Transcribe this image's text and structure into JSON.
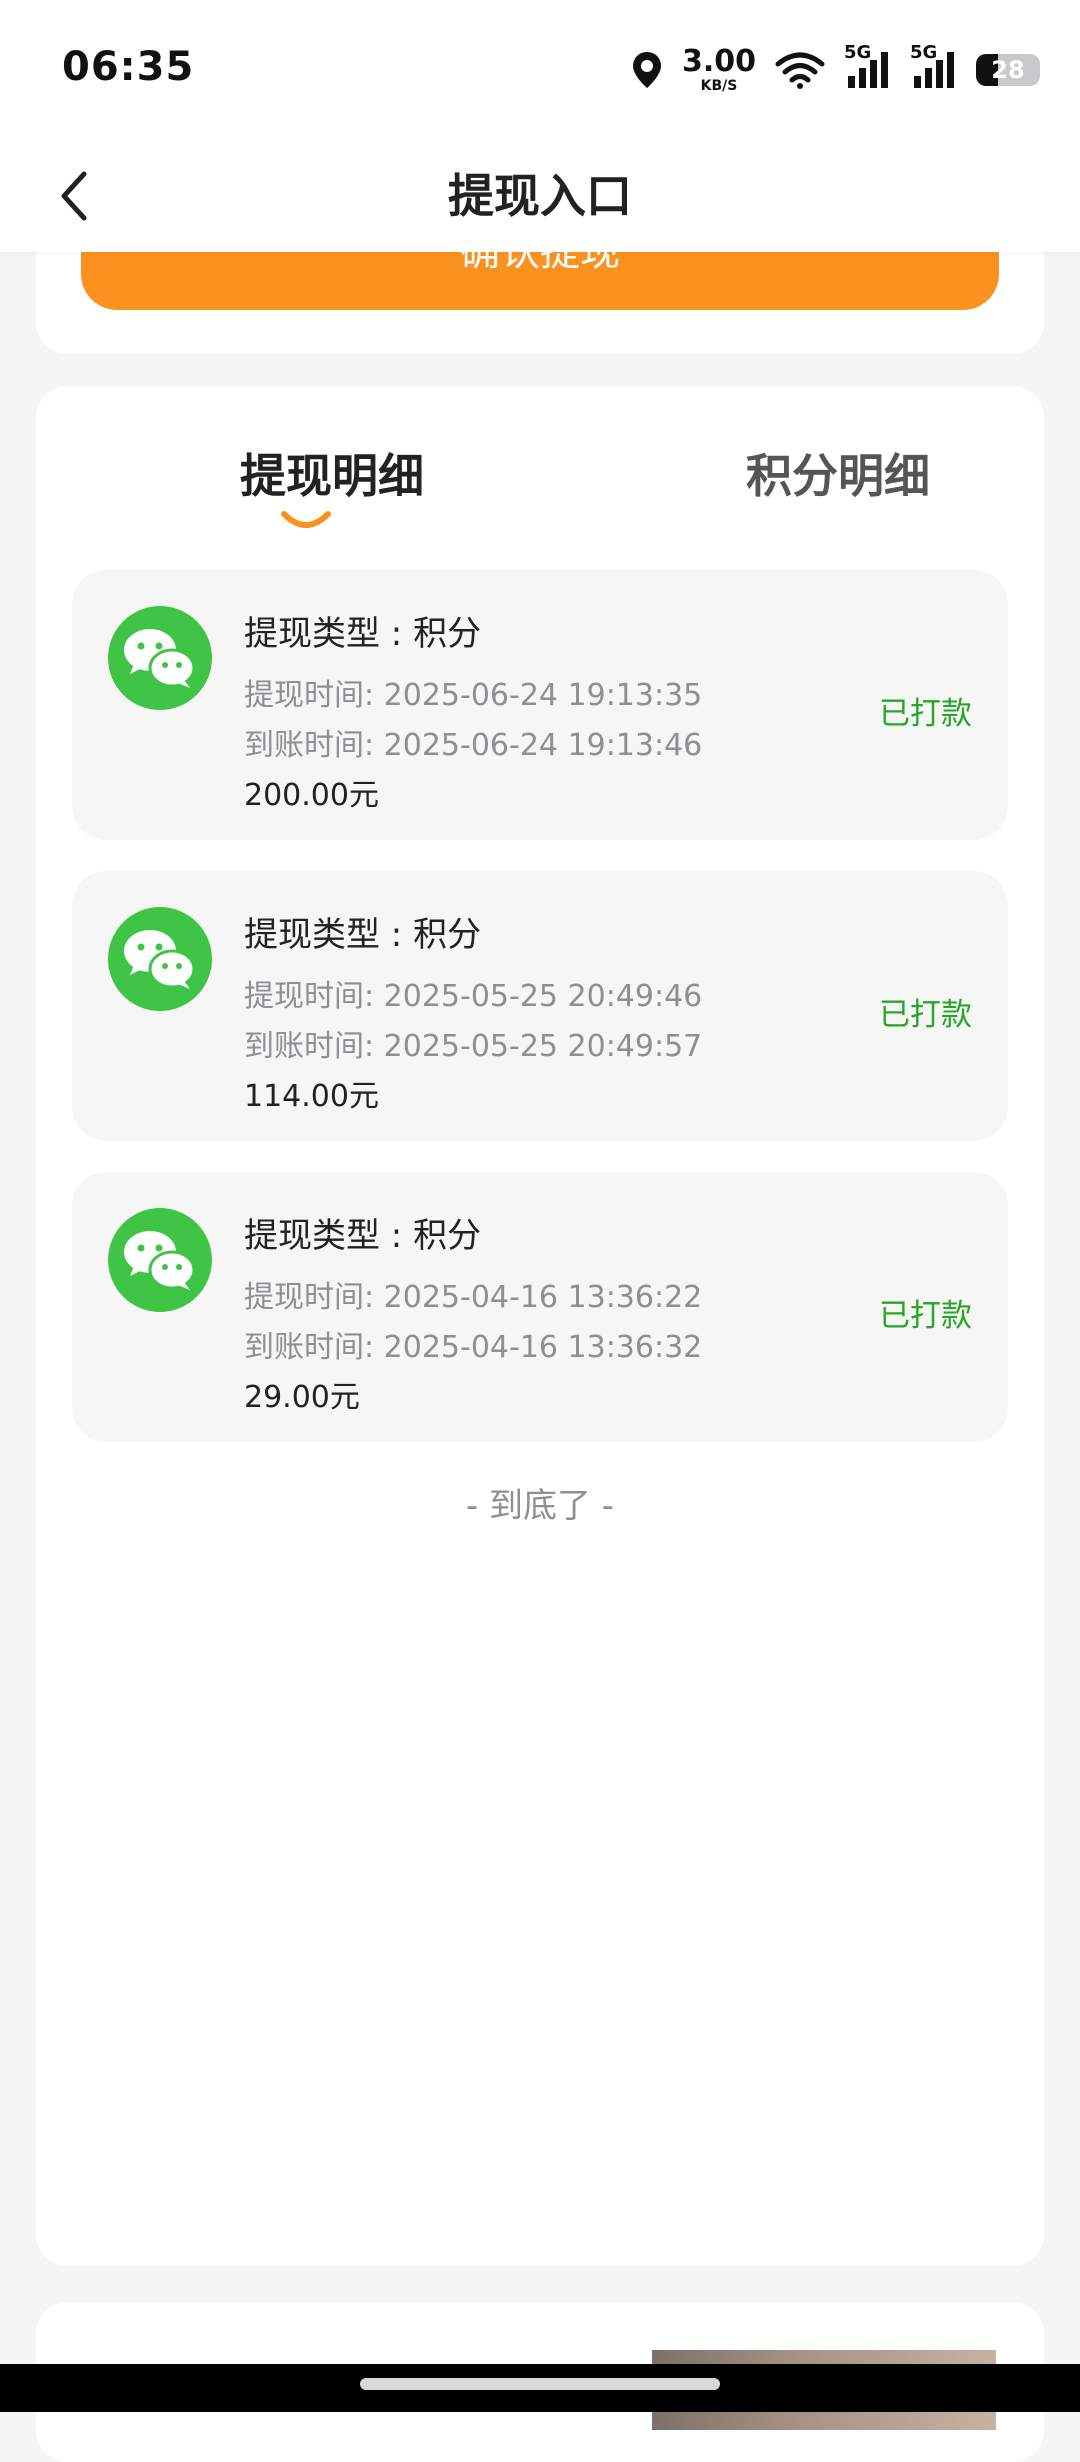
{
  "status_bar": {
    "time": "06:35",
    "net_speed_value": "3.00",
    "net_speed_unit": "KB/S",
    "network_1": "5G",
    "network_2": "5G",
    "battery": "28"
  },
  "header": {
    "title": "提现入口"
  },
  "top_card": {
    "confirm_label": "确认提现"
  },
  "tabs": [
    {
      "label": "提现明细",
      "active": true
    },
    {
      "label": "积分明细",
      "active": false
    }
  ],
  "records": [
    {
      "type": "提现类型 : 积分",
      "withdraw_time": "提现时间: 2025-06-24 19:13:35",
      "arrival_time": "到账时间: 2025-06-24 19:13:46",
      "amount": "200.00元",
      "status": "已打款"
    },
    {
      "type": "提现类型 : 积分",
      "withdraw_time": "提现时间: 2025-05-25 20:49:46",
      "arrival_time": "到账时间: 2025-05-25 20:49:57",
      "amount": "114.00元",
      "status": "已打款"
    },
    {
      "type": "提现类型 : 积分",
      "withdraw_time": "提现时间: 2025-04-16 13:36:22",
      "arrival_time": "到账时间: 2025-04-16 13:36:32",
      "amount": "29.00元",
      "status": "已打款"
    }
  ],
  "list_end": "- 到底了 -",
  "colors": {
    "accent_orange": "#fb921f",
    "wechat_green": "#3fc445",
    "status_green": "#27a627"
  },
  "icons": {
    "back": "chevron-left-icon",
    "record": "wechat-icon",
    "tab_indicator": "smile-underline-icon"
  }
}
